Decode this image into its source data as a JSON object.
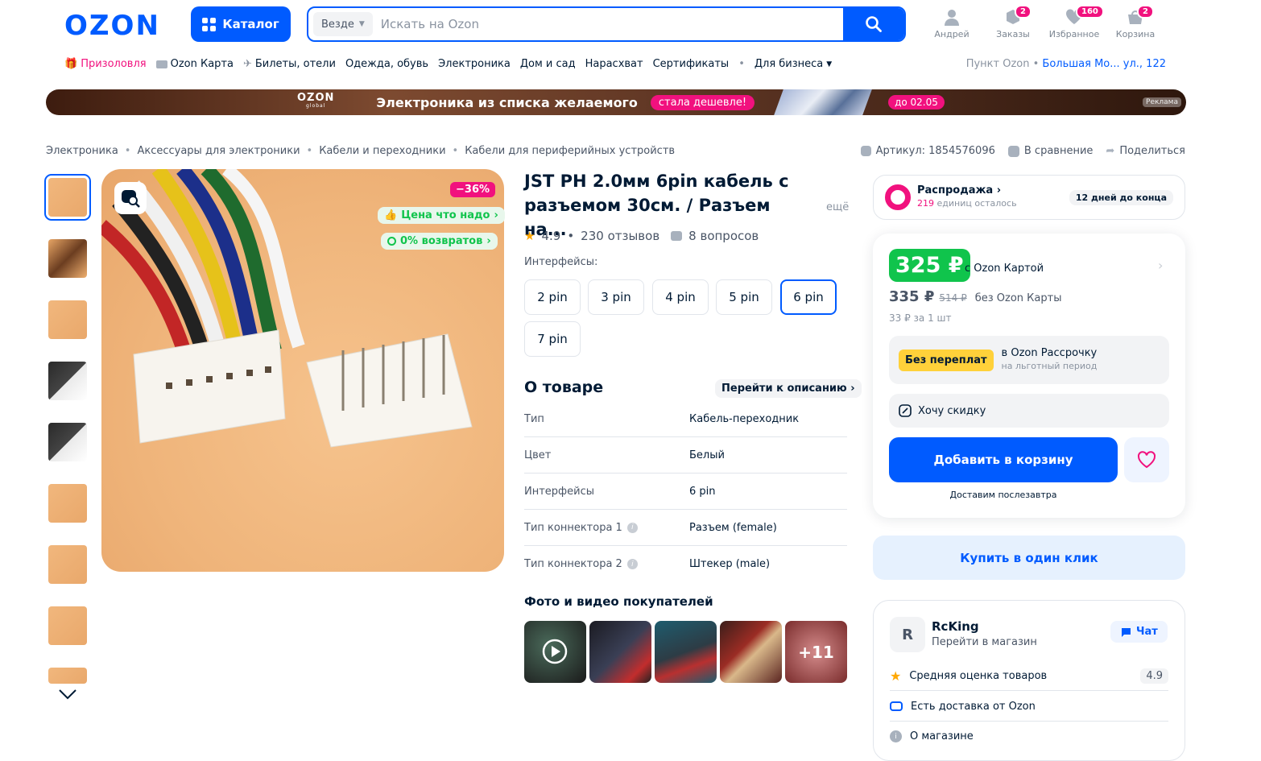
{
  "header": {
    "logo": "OZON",
    "catalog_label": "Каталог",
    "search_scope": "Везде",
    "search_placeholder": "Искать на Ozon",
    "user_label": "Андрей",
    "orders_label": "Заказы",
    "orders_count": "2",
    "favorites_label": "Избранное",
    "favorites_count": "160",
    "cart_label": "Корзина",
    "cart_count": "2"
  },
  "nav": {
    "items": [
      "Призоловля",
      "Ozon Карта",
      "Билеты, отели",
      "Одежда, обувь",
      "Электроника",
      "Дом и сад",
      "Нарасхват",
      "Сертификаты",
      "Для бизнеса"
    ],
    "pickup_label": "Пункт Ozon",
    "pickup_address": "Большая Мо... ул., 122"
  },
  "banner": {
    "logo": "OZON",
    "logo_sub": "global",
    "text": "Электроника из списка желаемого",
    "pill": "стала дешевле!",
    "date": "до 02.05",
    "ad": "Реклама"
  },
  "breadcrumbs": [
    "Электроника",
    "Аксессуары для электроники",
    "Кабели и переходники",
    "Кабели для периферийных устройств"
  ],
  "article": "Артикул: 1854576096",
  "compare_label": "В сравнение",
  "share_label": "Поделиться",
  "product": {
    "discount": "−36%",
    "tag_price": "Цена что надо",
    "tag_returns": "0% возвратов",
    "title": "JST PH 2.0мм 6pin кабель с разъемом 30см. / Разъем на...",
    "more": "ещё",
    "rating": "4.9",
    "reviews": "230 отзывов",
    "questions": "8 вопросов",
    "interfaces_label": "Интерфейсы:",
    "pins": [
      "2 pin",
      "3 pin",
      "4 pin",
      "5 pin",
      "6 pin",
      "7 pin"
    ],
    "selected_pin": "6 pin"
  },
  "about": {
    "title": "О товаре",
    "goto": "Перейти к описанию",
    "specs": [
      {
        "k": "Тип",
        "v": "Кабель-переходник"
      },
      {
        "k": "Цвет",
        "v": "Белый"
      },
      {
        "k": "Интерфейсы",
        "v": "6 pin"
      },
      {
        "k": "Тип коннектора 1",
        "v": "Разъем (female)"
      },
      {
        "k": "Тип коннектора 2",
        "v": "Штекер (male)"
      }
    ]
  },
  "photos": {
    "title": "Фото и видео покупателей",
    "more_count": "+11"
  },
  "sale": {
    "title": "Распродажа",
    "units_left_num": "219",
    "units_left_text": "единиц осталось",
    "days": "12 дней до конца"
  },
  "price": {
    "card_price": "325 ₽",
    "card_label": "с Ozon Картой",
    "regular": "335 ₽",
    "old": "514 ₽",
    "regular_label": "без Ozon Карты",
    "per_unit": "33 ₽ за 1 шт",
    "installment_badge": "Без переплат",
    "installment_title": "в Ozon Рассрочку",
    "installment_sub": "на льготный период",
    "want_discount": "Хочу скидку",
    "add_to_cart": "Добавить в корзину",
    "delivery": "Доставим послезавтра",
    "one_click": "Купить в один клик"
  },
  "seller": {
    "avatar_letter": "R",
    "name": "RcKing",
    "goto": "Перейти в магазин",
    "chat": "Чат",
    "avg_label": "Средняя оценка товаров",
    "avg_score": "4.9",
    "delivery_label": "Есть доставка от Ozon",
    "about_label": "О магазине"
  },
  "colors": {
    "brand": "#005bff",
    "pink": "#f1117e",
    "green": "#10c44c",
    "yellow": "#ffd13a"
  }
}
